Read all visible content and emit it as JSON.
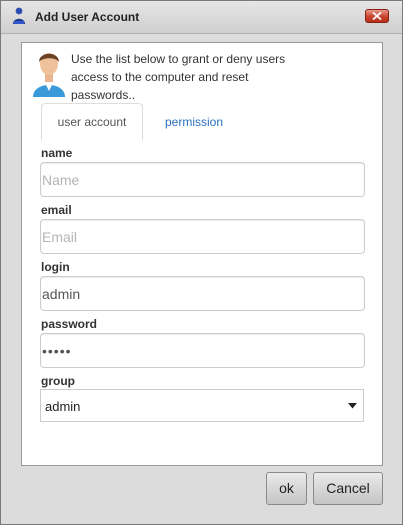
{
  "window": {
    "title": "Add User Account",
    "icons": {
      "title": "user-icon",
      "close": "close-icon"
    }
  },
  "intro": {
    "text": "Use the list below to grant or deny users access to the computer and reset passwords..",
    "icon": "user-avatar-icon"
  },
  "tabs": [
    {
      "label": "user account",
      "active": true
    },
    {
      "label": "permission",
      "active": false
    }
  ],
  "form": {
    "name": {
      "label": "name",
      "value": "",
      "placeholder": "Name"
    },
    "email": {
      "label": "email",
      "value": "",
      "placeholder": "Email"
    },
    "login": {
      "label": "login",
      "value": "admin",
      "placeholder": ""
    },
    "password": {
      "label": "password",
      "value": "•••••",
      "placeholder": ""
    },
    "group": {
      "label": "group",
      "selected": "admin"
    }
  },
  "buttons": {
    "ok": "ok",
    "cancel": "Cancel"
  },
  "colors": {
    "accent_link": "#2a6fbf",
    "close_button": "#c9432d"
  }
}
